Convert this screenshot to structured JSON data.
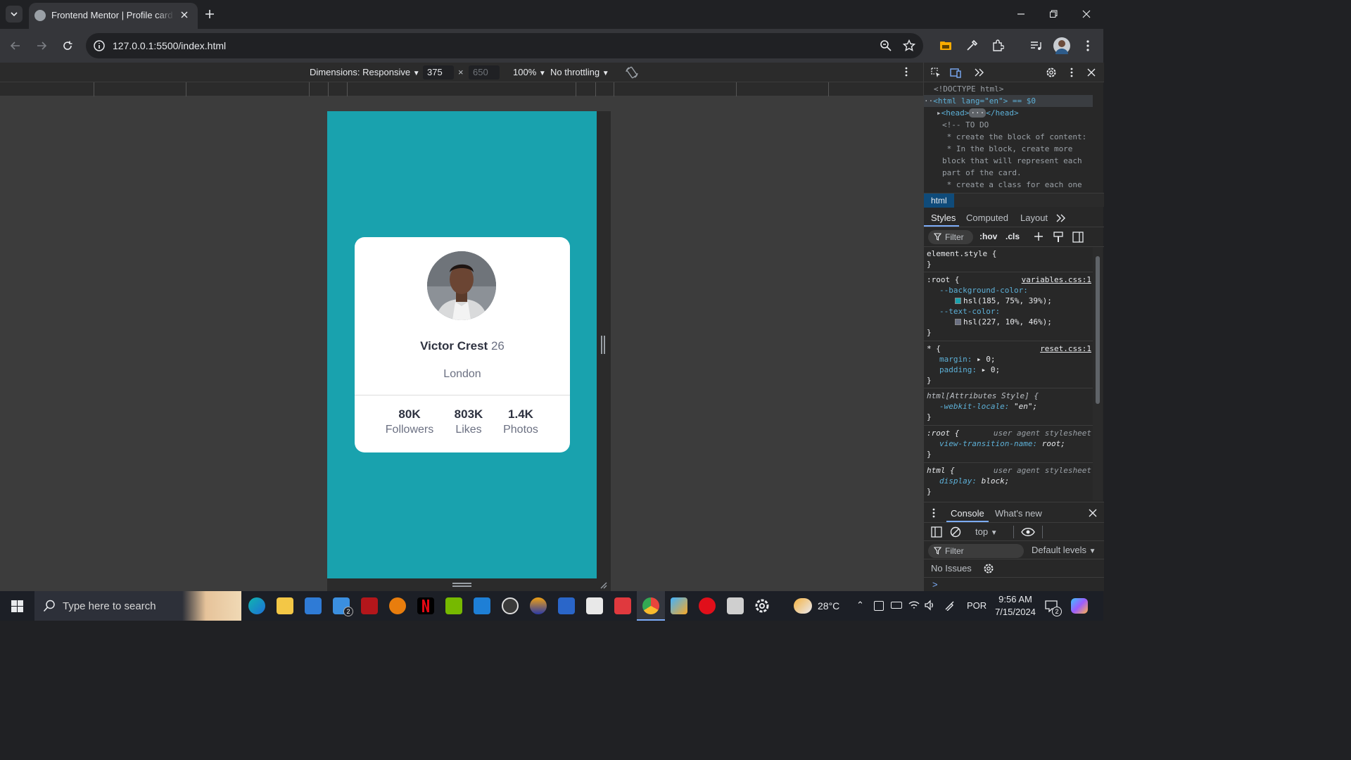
{
  "browser": {
    "tab_title": "Frontend Mentor | Profile card c",
    "url": "127.0.0.1:5500/index.html"
  },
  "device_toolbar": {
    "dimensions_label": "Dimensions: Responsive",
    "width": "375",
    "times": "×",
    "height_placeholder": "650",
    "zoom": "100%",
    "throttling": "No throttling"
  },
  "card": {
    "name": "Victor Crest",
    "age": "26",
    "city": "London",
    "stats": [
      {
        "value": "80K",
        "label": "Followers"
      },
      {
        "value": "803K",
        "label": "Likes"
      },
      {
        "value": "1.4K",
        "label": "Photos"
      }
    ],
    "background_color": "#19a2ae"
  },
  "devtools": {
    "elements": [
      "<!DOCTYPE html>",
      "<html lang=\"en\"> == $0",
      "<head>",
      "</head>",
      "<!-- TO DO",
      " * create the block of content:",
      " * In the block, create more",
      "block that will represent each",
      "part of the card.",
      " * create a class for each one"
    ],
    "breadcrumb": "html",
    "tabs": [
      "Styles",
      "Computed",
      "Layout"
    ],
    "filter_label": "Filter",
    "hov": ":hov",
    "cls": ".cls",
    "styles": {
      "element_style": "element.style {",
      "close": "}",
      "root_sel": ":root {",
      "root_src": "variables.css:1",
      "bg_prop": "--background-color",
      "bg_val": "hsl(185, 75%, 39%);",
      "text_prop": "--text-color",
      "text_val": "hsl(227, 10%, 46%);",
      "star_sel": "* {",
      "star_src": "reset.css:1",
      "margin_prop": "margin",
      "margin_val": "0;",
      "padding_prop": "padding",
      "padding_val": "0;",
      "attr_sel": "html[Attributes Style] {",
      "locale_prop": "-webkit-locale",
      "locale_val": "\"en\";",
      "ua_root_sel": ":root {",
      "ua_src": "user agent stylesheet",
      "vt_prop": "view-transition-name",
      "vt_val": "root;",
      "html_sel": "html {",
      "display_prop": "display",
      "display_val": "block;"
    },
    "swatch_bg": "#19a2ae",
    "swatch_text": "#6b7082",
    "console": {
      "tabs": [
        "Console",
        "What's new"
      ],
      "context": "top",
      "filter": "Filter",
      "levels": "Default levels",
      "issues": "No Issues",
      "prompt": ">"
    }
  },
  "taskbar": {
    "search_placeholder": "Type here to search",
    "temperature": "28°C",
    "language": "POR",
    "time": "9:56 AM",
    "date": "7/15/2024",
    "notification_count": "2",
    "mail_badge": "2"
  }
}
